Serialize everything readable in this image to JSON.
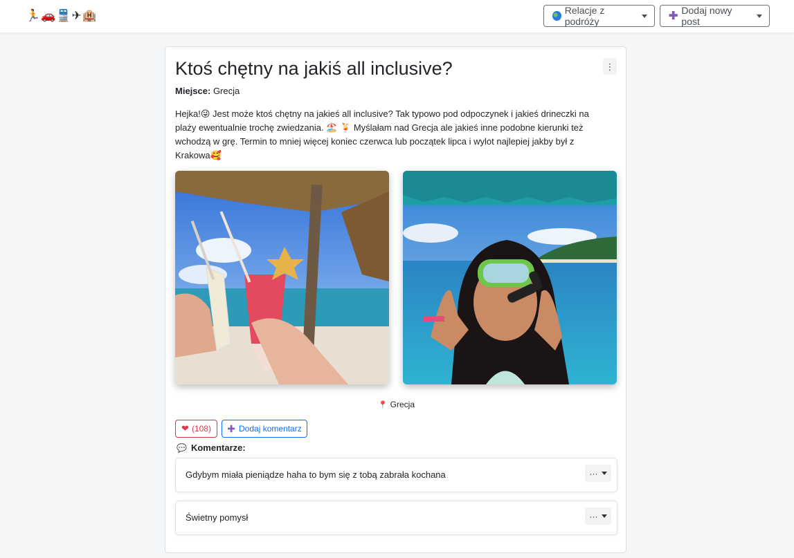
{
  "navbar": {
    "logo_emoji": [
      "🏃",
      "🚗",
      "🚆",
      "✈",
      "🏨"
    ],
    "travel_relations_label": "Relacje z podróży",
    "add_post_label": "Dodaj nowy post"
  },
  "post": {
    "title": "Ktoś chętny na jakiś all inclusive?",
    "place_label": "Miejsce:",
    "place_value": "Grecja",
    "body": "Hejka!😜 Jest może ktoś chętny na jakieś all inclusive? Tak typowo pod odpoczynek i jakieś drineczki na plaży ewentualnie trochę zwiedzania. 🏖️ 🍹 Myślałam nad Grecja ale jakieś inne podobne kierunki też wchodzą w grę. Termin to mniej więcej koniec czerwca lub początek lipca i wylot najlepiej jakby był z Krakowa🥰",
    "photos": [
      {
        "name": "cocktails-on-beach-photo"
      },
      {
        "name": "snorkeling-girl-photo"
      }
    ],
    "location": "Grecja",
    "likes": "(108)",
    "add_comment_label": "Dodaj komentarz",
    "comments_heading": "Komentarze:"
  },
  "comments": [
    {
      "text": "Gdybym miała pieniądze haha to bym się z tobą zabrała kochana"
    },
    {
      "text": "Świetny pomysł"
    }
  ],
  "colors": {
    "like": "#dc3545",
    "comment_button": "#0d6efd",
    "add_post_icon": "#7d5bb7"
  }
}
